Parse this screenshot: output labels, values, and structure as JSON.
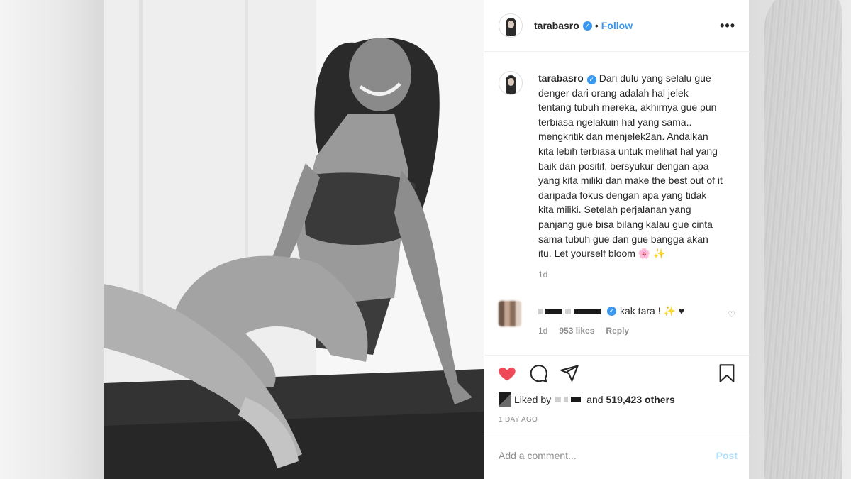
{
  "post": {
    "username": "tarabasro",
    "follow_label": "Follow",
    "more_label": "•••",
    "separator": "•",
    "caption": "Dari dulu yang selalu gue\ndenger dari orang adalah hal jelek\ntentang tubuh mereka, akhirnya gue pun\nterbiasa ngelakuin hal yang sama..\nmengkritik dan menjelek2an. Andaikan\nkita lebih terbiasa untuk melihat hal yang\nbaik dan positif, bersyukur dengan apa\nyang kita miliki dan make the best out of it\ndaripada fokus dengan apa yang tidak\nkita miliki. Setelah perjalanan yang\npanjang gue bisa bilang kalau gue cinta\nsama tubuh gue dan gue bangga akan\nitu. Let yourself bloom 🌸 ✨",
    "caption_time": "1d"
  },
  "comment": {
    "text": "kak tara ! ✨ ♥",
    "time": "1d",
    "likes": "953 likes",
    "reply_label": "Reply"
  },
  "likes": {
    "prefix": "Liked by",
    "conjunction": "and",
    "count": "519,423 others"
  },
  "date_label": "1 DAY AGO",
  "composer": {
    "placeholder": "Add a comment...",
    "post_label": "Post"
  },
  "colors": {
    "accent": "#3897f0",
    "like_red": "#ed4956",
    "muted": "#8e8e8e",
    "post_disabled": "#b2dffc"
  },
  "icons": [
    "more-icon",
    "verified-icon",
    "heart-filled-icon",
    "comment-icon",
    "share-icon",
    "bookmark-icon",
    "carousel-next-icon",
    "comment-heart-icon"
  ]
}
